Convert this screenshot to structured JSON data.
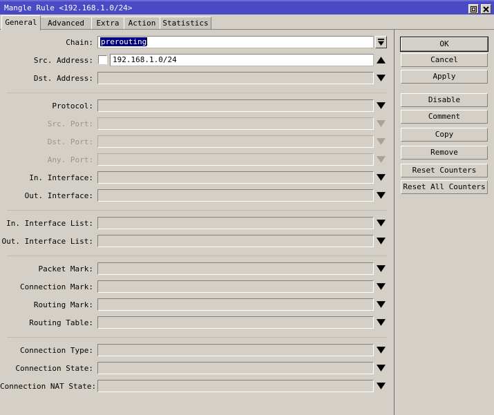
{
  "window": {
    "title": "Mangle Rule <192.168.1.0/24>",
    "titlebar_color": "#4a4ac4",
    "face_color": "#d4d0c8",
    "controls": [
      {
        "name": "maximize",
        "icon": "maximize-icon"
      },
      {
        "name": "close",
        "icon": "close-icon"
      }
    ]
  },
  "tabs": {
    "items": [
      {
        "label": "General",
        "active": true
      },
      {
        "label": "Advanced",
        "active": false
      },
      {
        "label": "Extra",
        "active": false
      },
      {
        "label": "Action",
        "active": false
      },
      {
        "label": "Statistics",
        "active": false
      }
    ]
  },
  "form": {
    "groups": [
      {
        "fields": [
          {
            "label": "Chain:",
            "value": "prerouting",
            "value_selected": true,
            "style": "white",
            "control": "drop-button",
            "enabled": true,
            "checkbox": false
          },
          {
            "label": "Src. Address:",
            "value": "192.168.1.0/24",
            "style": "white",
            "control": "arrow-up",
            "enabled": true,
            "checkbox": true,
            "checked": false
          },
          {
            "label": "Dst. Address:",
            "value": "",
            "style": "plain",
            "control": "arrow-down",
            "enabled": true,
            "checkbox": false
          }
        ]
      },
      {
        "fields": [
          {
            "label": "Protocol:",
            "value": "",
            "style": "plain",
            "control": "arrow-down",
            "enabled": true,
            "checkbox": false
          },
          {
            "label": "Src. Port:",
            "value": "",
            "style": "plain",
            "control": "arrow-down",
            "enabled": false,
            "checkbox": false
          },
          {
            "label": "Dst. Port:",
            "value": "",
            "style": "plain",
            "control": "arrow-down",
            "enabled": false,
            "checkbox": false
          },
          {
            "label": "Any. Port:",
            "value": "",
            "style": "plain",
            "control": "arrow-down",
            "enabled": false,
            "checkbox": false
          },
          {
            "label": "In. Interface:",
            "value": "",
            "style": "plain",
            "control": "arrow-down",
            "enabled": true,
            "checkbox": false
          },
          {
            "label": "Out. Interface:",
            "value": "",
            "style": "plain",
            "control": "arrow-down",
            "enabled": true,
            "checkbox": false
          }
        ]
      },
      {
        "fields": [
          {
            "label": "In. Interface List:",
            "value": "",
            "style": "plain",
            "control": "arrow-down",
            "enabled": true,
            "checkbox": false
          },
          {
            "label": "Out. Interface List:",
            "value": "",
            "style": "plain",
            "control": "arrow-down",
            "enabled": true,
            "checkbox": false
          }
        ]
      },
      {
        "fields": [
          {
            "label": "Packet Mark:",
            "value": "",
            "style": "plain",
            "control": "arrow-down",
            "enabled": true,
            "checkbox": false
          },
          {
            "label": "Connection Mark:",
            "value": "",
            "style": "plain",
            "control": "arrow-down",
            "enabled": true,
            "checkbox": false
          },
          {
            "label": "Routing Mark:",
            "value": "",
            "style": "plain",
            "control": "arrow-down",
            "enabled": true,
            "checkbox": false
          },
          {
            "label": "Routing Table:",
            "value": "",
            "style": "plain",
            "control": "arrow-down",
            "enabled": true,
            "checkbox": false
          }
        ]
      },
      {
        "fields": [
          {
            "label": "Connection Type:",
            "value": "",
            "style": "plain",
            "control": "arrow-down",
            "enabled": true,
            "checkbox": false
          },
          {
            "label": "Connection State:",
            "value": "",
            "style": "plain",
            "control": "arrow-down",
            "enabled": true,
            "checkbox": false
          },
          {
            "label": "Connection NAT State:",
            "value": "",
            "style": "plain",
            "control": "arrow-down",
            "enabled": true,
            "checkbox": false
          }
        ]
      }
    ]
  },
  "actions": {
    "buttons": [
      {
        "label": "OK",
        "default": true
      },
      {
        "label": "Cancel",
        "default": false
      },
      {
        "label": "Apply",
        "default": false
      },
      {
        "label": "Disable",
        "default": false
      },
      {
        "label": "Comment",
        "default": false
      },
      {
        "label": "Copy",
        "default": false
      },
      {
        "label": "Remove",
        "default": false
      },
      {
        "label": "Reset Counters",
        "default": false
      },
      {
        "label": "Reset All Counters",
        "default": false
      }
    ]
  }
}
